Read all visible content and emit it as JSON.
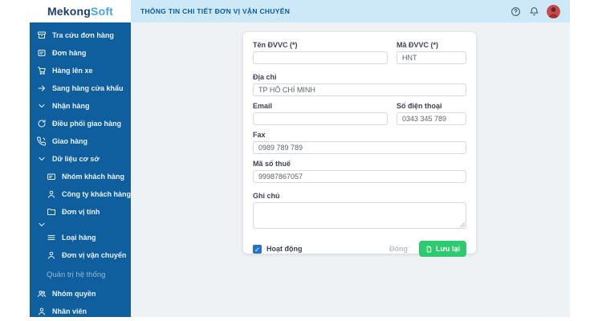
{
  "logo": {
    "brand_bold": "Mekong",
    "brand_light": "Soft"
  },
  "header": {
    "title": "THÔNG TIN CHI TIẾT ĐƠN VỊ VẬN CHUYỂN",
    "icons": [
      "help-icon",
      "bell-icon",
      "user-avatar"
    ]
  },
  "sidebar": {
    "items": [
      {
        "label": "Tra cứu đơn hàng",
        "icon": "archive-box-icon",
        "level": "top"
      },
      {
        "label": "Đơn hàng",
        "icon": "document-lines-icon",
        "level": "top"
      },
      {
        "label": "Hàng lên xe",
        "icon": "cart-icon",
        "level": "top"
      },
      {
        "label": "Sang hàng cửa khẩu",
        "icon": "arrow-right-icon",
        "level": "top"
      },
      {
        "label": "Nhận hàng",
        "icon": "chevron-down-icon",
        "level": "top"
      },
      {
        "label": "Điều phối giao hàng",
        "icon": "refresh-icon",
        "level": "top"
      },
      {
        "label": "Giao hàng",
        "icon": "phone-icon",
        "level": "top"
      },
      {
        "label": "Dữ liệu cơ sở",
        "icon": "chevron-down-icon",
        "level": "group"
      },
      {
        "label": "Nhóm khách hàng",
        "icon": "id-card-icon",
        "level": "sub"
      },
      {
        "label": "Công ty khách hàng",
        "icon": "person-icon",
        "level": "sub"
      },
      {
        "label": "Đơn vị tính",
        "icon": "folder-icon",
        "level": "sub"
      },
      {
        "label": "",
        "icon": "chevron-down-icon",
        "level": "group"
      },
      {
        "label": "Loại hàng",
        "icon": "menu-icon",
        "level": "sub"
      },
      {
        "label": "Đơn vị vận chuyển",
        "icon": "person-icon",
        "level": "sub"
      },
      {
        "label": "Quản trị hệ thống",
        "icon": null,
        "level": "section"
      },
      {
        "label": "Nhóm quyền",
        "icon": "people-icon",
        "level": "top"
      },
      {
        "label": "Nhân viên",
        "icon": "person-icon",
        "level": "top"
      }
    ]
  },
  "form": {
    "fields": {
      "ten_dvvc": {
        "label": "Tên ĐVVC (*)",
        "value": ""
      },
      "ma_dvvc": {
        "label": "Mã ĐVVC (*)",
        "value": "HNT"
      },
      "dia_chi": {
        "label": "Địa chỉ",
        "value": "TP HỒ CHÍ MINH"
      },
      "email": {
        "label": "Email",
        "value": ""
      },
      "so_dien_thoai": {
        "label": "Số điện thoại",
        "value": "0343 345 789"
      },
      "fax": {
        "label": "Fax",
        "value": "0989 789 789"
      },
      "ma_so_thue": {
        "label": "Mã số thuế",
        "value": "99987867057"
      },
      "ghi_chu": {
        "label": "Ghi chú",
        "value": ""
      }
    },
    "footer": {
      "active_label": "Hoạt động",
      "active_checked": true,
      "close_label": "Đóng",
      "save_label": "Lưu lại"
    }
  },
  "colors": {
    "sidebar_bg": "#0f5e9e",
    "header_bg": "#cde8f7",
    "header_title": "#0a5a9e",
    "content_bg": "#eff2f5",
    "save_green": "#2eca70",
    "checkbox_blue": "#2176c7",
    "logo_dark": "#1c3f6e",
    "logo_light": "#4aa3dc"
  }
}
